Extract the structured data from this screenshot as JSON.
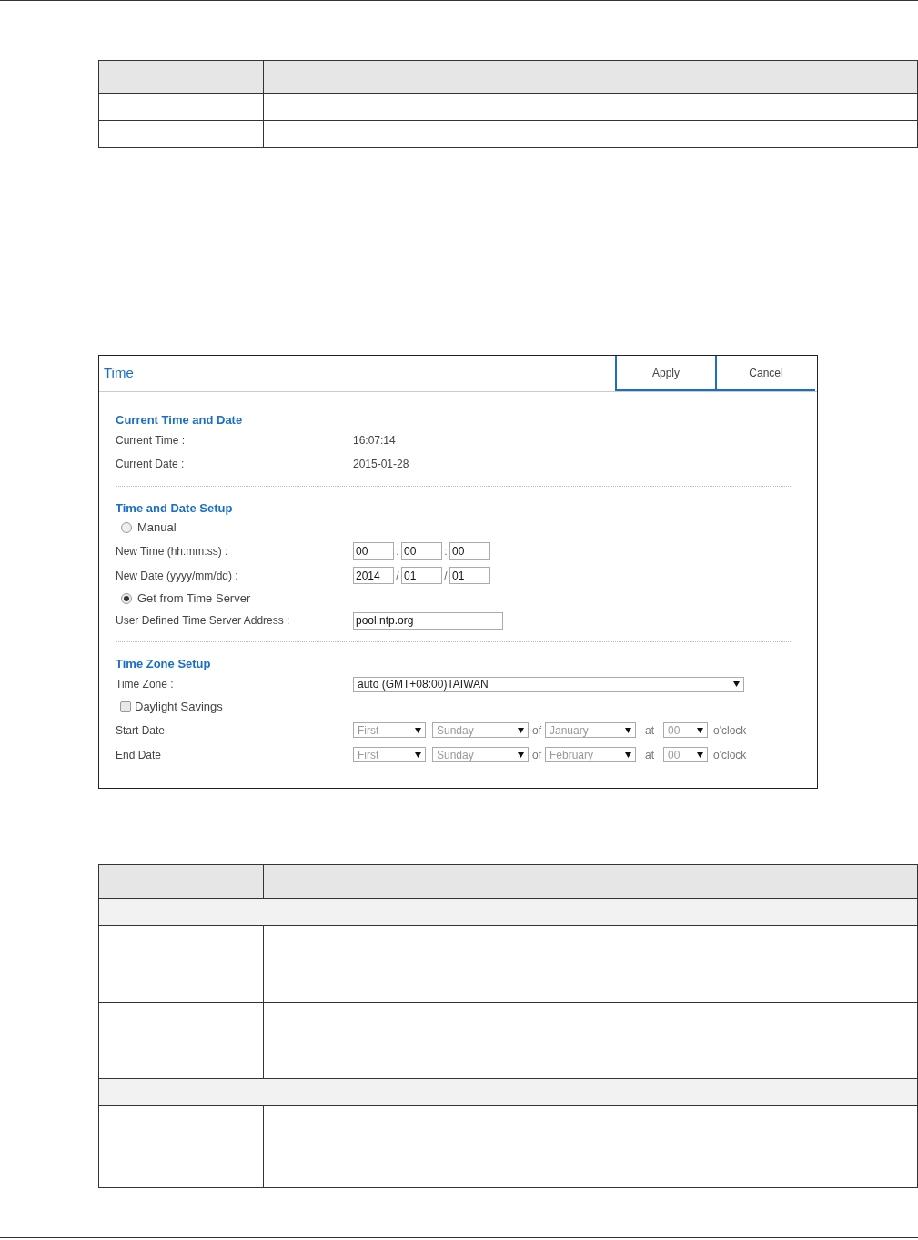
{
  "window": {
    "title": "Time"
  },
  "buttons": [
    {
      "label": "Apply"
    },
    {
      "label": "Cancel"
    }
  ],
  "sections": [
    {
      "title": "Current Time and Date",
      "rows": [
        {
          "kind": "readout",
          "label": "Current Time :",
          "value": "16:07:14"
        },
        {
          "kind": "readout",
          "label": "Current Date :",
          "value": "2015-01-28"
        }
      ]
    },
    {
      "title": "Time and Date Setup",
      "rows": [
        {
          "kind": "radio",
          "label": "Manual",
          "selected": false
        },
        {
          "kind": "fields",
          "label": "New Time (hh:mm:ss) :",
          "fields": [
            "00",
            "00",
            "00"
          ],
          "separators": [
            ":",
            ":"
          ]
        },
        {
          "kind": "fields",
          "label": "New Date (yyyy/mm/dd) :",
          "fields": [
            "2014",
            "01",
            "01"
          ],
          "separators": [
            "/",
            "/"
          ]
        },
        {
          "kind": "radio",
          "label": "Get from Time Server",
          "selected": true
        },
        {
          "kind": "text",
          "label": "User Defined Time Server Address :",
          "value": "pool.ntp.org"
        }
      ]
    },
    {
      "title": "Time Zone Setup",
      "rows": [
        {
          "kind": "select",
          "label": "Time Zone :",
          "value": "auto (GMT+08:00)TAIWAN"
        },
        {
          "kind": "checkbox",
          "label": "Daylight Savings",
          "checked": false
        },
        {
          "kind": "schedule",
          "label": "Start Date",
          "disabled": true,
          "week": "First",
          "day": "Sunday",
          "of": "of",
          "month": "January",
          "at": "at",
          "hour": "00",
          "suffix": "o'clock"
        },
        {
          "kind": "schedule",
          "label": "End Date",
          "disabled": true,
          "week": "First",
          "day": "Sunday",
          "of": "of",
          "month": "February",
          "at": "at",
          "hour": "00",
          "suffix": "o'clock"
        }
      ]
    }
  ]
}
